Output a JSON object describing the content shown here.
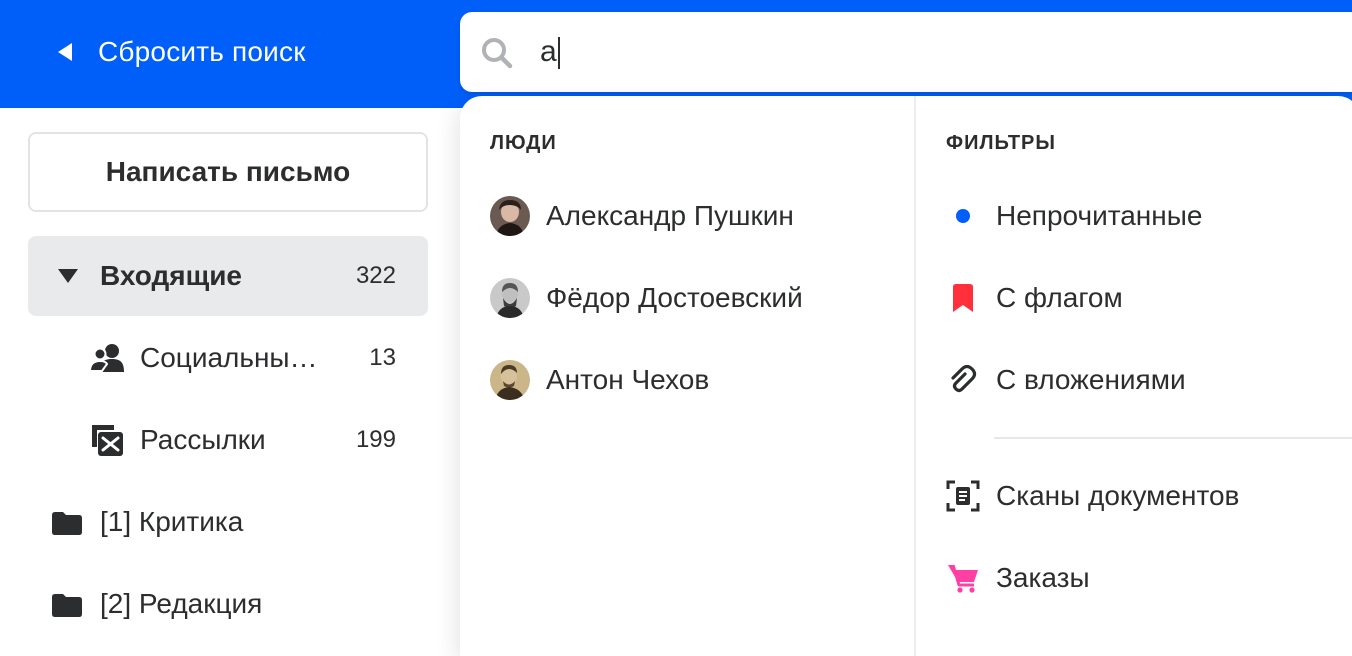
{
  "header": {
    "reset_label": "Сбросить поиск",
    "search_value": "а"
  },
  "sidebar": {
    "compose_label": "Написать письмо",
    "folders": [
      {
        "label": "Входящие",
        "count": "322",
        "icon": "triangle-down-icon"
      },
      {
        "label": "Социальны…",
        "count": "13",
        "icon": "people-icon"
      },
      {
        "label": "Рассылки",
        "count": "199",
        "icon": "newsletter-icon"
      },
      {
        "label": "[1] Критика",
        "count": "",
        "icon": "folder-icon"
      },
      {
        "label": "[2] Редакция",
        "count": "",
        "icon": "folder-icon"
      }
    ]
  },
  "dropdown": {
    "people_title": "ЛЮДИ",
    "people": [
      {
        "name": "Александр Пушкин"
      },
      {
        "name": "Фёдор Достоевский"
      },
      {
        "name": "Антон Чехов"
      }
    ],
    "filters_title": "ФИЛЬТРЫ",
    "filters": [
      {
        "label": "Непрочитанные",
        "icon": "unread-dot-icon",
        "color": "#005ff9"
      },
      {
        "label": "С флагом",
        "icon": "flag-icon",
        "color": "#ff2f3b"
      },
      {
        "label": "С вложениями",
        "icon": "paperclip-icon",
        "color": "#2c2d2e"
      },
      {
        "label": "Сканы документов",
        "icon": "scan-document-icon",
        "color": "#2c2d2e"
      },
      {
        "label": "Заказы",
        "icon": "cart-icon",
        "color": "#ff3fa4"
      }
    ]
  },
  "colors": {
    "accent": "#005ff9",
    "text": "#2c2d2e",
    "active_bg": "#e9eaec"
  }
}
